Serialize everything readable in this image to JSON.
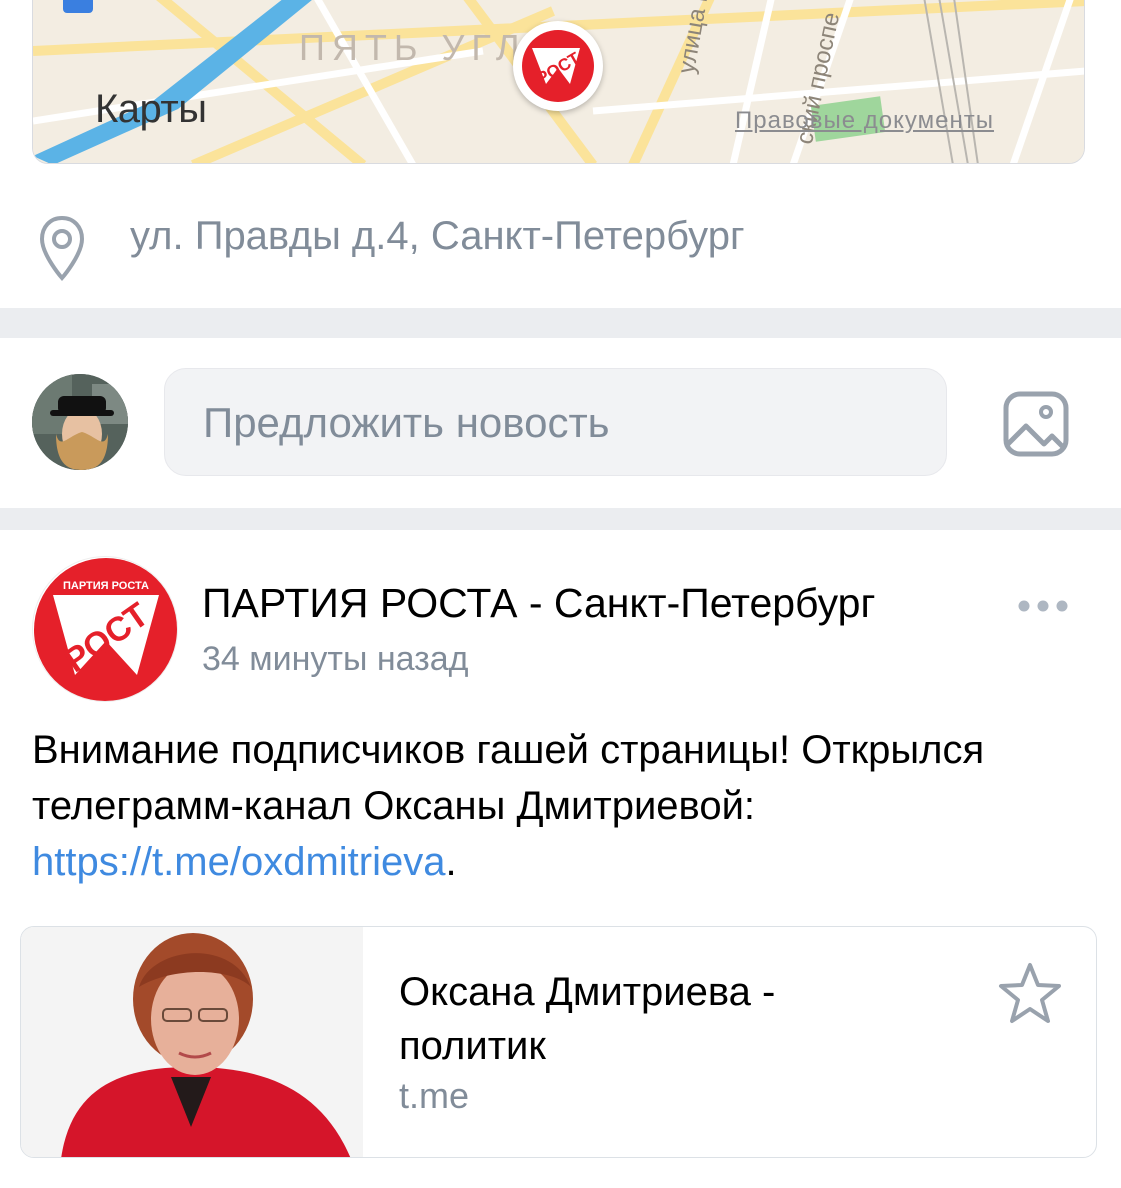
{
  "map": {
    "maps_label": "Карты",
    "district_label": "ПЯТЬ УГЛ",
    "street_label_1": "улица М",
    "street_label_2": "ский проспе",
    "legal_link": "Правовые документы",
    "pin_logo_text": "РОСТ"
  },
  "address": {
    "text": "ул. Правды д.4, Санкт-Петербург",
    "icon": "location-pin-icon"
  },
  "suggest": {
    "placeholder": "Предложить новость",
    "photo_icon": "image-icon"
  },
  "post": {
    "group_name": "ПАРТИЯ РОСТА - Санкт-Петербург",
    "time": "34 минуты назад",
    "avatar_top_text": "ПАРТИЯ РОСТА",
    "avatar_logo_text": "РОСТ",
    "text_part1": "Внимание подписчиков гашей страницы! Открылся телеграмм-канал Оксаны Дмитриевой: ",
    "link": "https://t.me/oxdmitrieva",
    "text_end": ".",
    "more_icon": "more-dots-icon"
  },
  "card": {
    "title": "Оксана Дмитриева - политик",
    "domain": "t.me",
    "star_icon": "star-icon"
  },
  "colors": {
    "link": "#3f8ae0",
    "secondary_text": "#818c99",
    "separator": "#ebedf0",
    "brand_red": "#e5202a"
  }
}
